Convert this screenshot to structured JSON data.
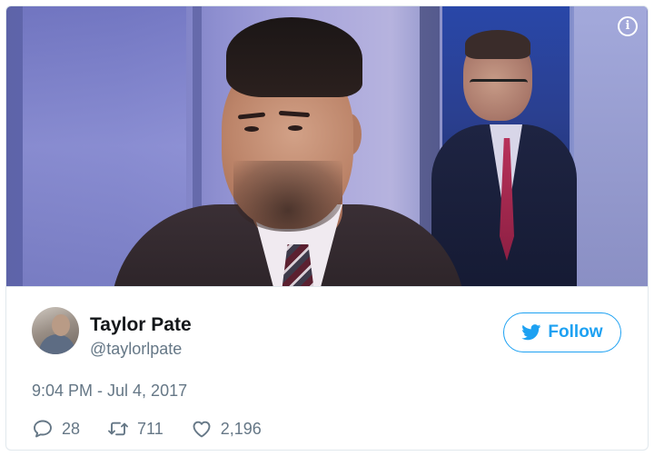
{
  "colors": {
    "accent": "#1da1f2",
    "secondary_text": "#657786",
    "primary_text": "#14171a",
    "border": "#e1e8ed"
  },
  "media": {
    "info_icon": "info-icon",
    "info_glyph": "i"
  },
  "author": {
    "name": "Taylor Pate",
    "handle": "@taylorlpate",
    "avatar_icon": "avatar"
  },
  "follow_button": {
    "label": "Follow",
    "icon": "twitter-bird-icon"
  },
  "tweet": {
    "timestamp": "9:04 PM - Jul 4, 2017"
  },
  "actions": {
    "replies": {
      "icon": "reply-icon",
      "count": "28"
    },
    "retweets": {
      "icon": "retweet-icon",
      "count": "711"
    },
    "likes": {
      "icon": "heart-icon",
      "count": "2,196"
    }
  }
}
